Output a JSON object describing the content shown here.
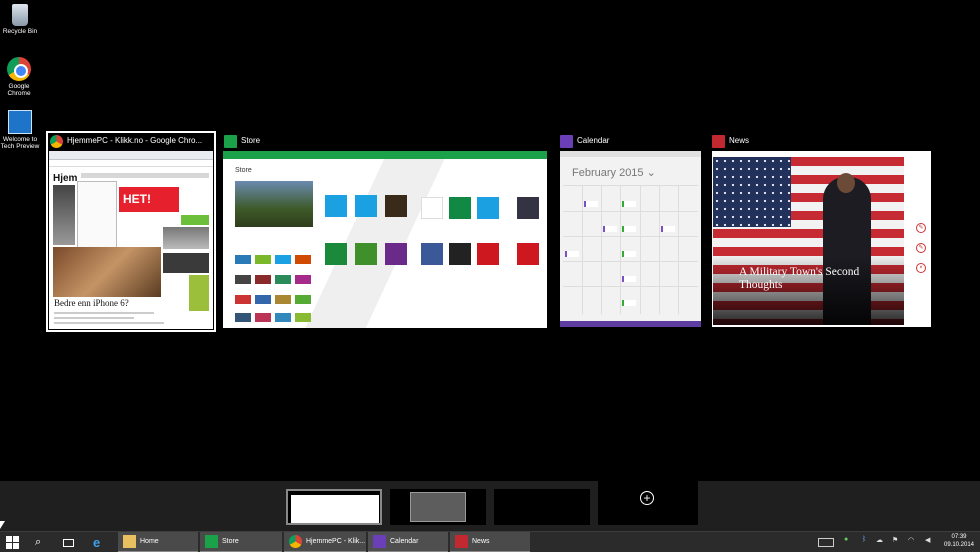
{
  "desktop": {
    "icons": [
      {
        "label": "Recycle Bin",
        "icon": "recycle-bin-icon"
      },
      {
        "label": "Google Chrome",
        "icon": "chrome-icon"
      },
      {
        "label": "Welcome to Tech Preview",
        "icon": "tech-preview-icon"
      }
    ]
  },
  "task_view": {
    "windows": [
      {
        "title": "HjemmePC - Klikk.no - Google Chro...",
        "icon": "chrome-icon",
        "content": {
          "logo": "Hjem",
          "banner": "HET!",
          "headline": "Bedre enn iPhone 6?"
        }
      },
      {
        "title": "Store",
        "icon": "store-icon",
        "content": {
          "heading": "Store"
        }
      },
      {
        "title": "Calendar",
        "icon": "calendar-icon",
        "content": {
          "month": "February 2015 ⌄"
        }
      },
      {
        "title": "News",
        "icon": "news-icon",
        "content": {
          "headline": "A Military Town's Second Thoughts"
        }
      }
    ]
  },
  "virtual_desktops": {
    "add_label": "+"
  },
  "taskbar": {
    "buttons": [
      {
        "label": "Home",
        "icon": "home-folder-icon"
      },
      {
        "label": "Store",
        "icon": "store-icon"
      },
      {
        "label": "HjemmePC - Klik...",
        "icon": "chrome-icon"
      },
      {
        "label": "Calendar",
        "icon": "calendar-icon"
      },
      {
        "label": "News",
        "icon": "news-icon"
      }
    ],
    "clock": {
      "time": "07:39",
      "date": "09.10.2014"
    }
  },
  "colors": {
    "store_green": "#1aa14a",
    "calendar_purple": "#5e3ca0",
    "news_red": "#c2282f",
    "taskbar": "#2b2b2b"
  }
}
